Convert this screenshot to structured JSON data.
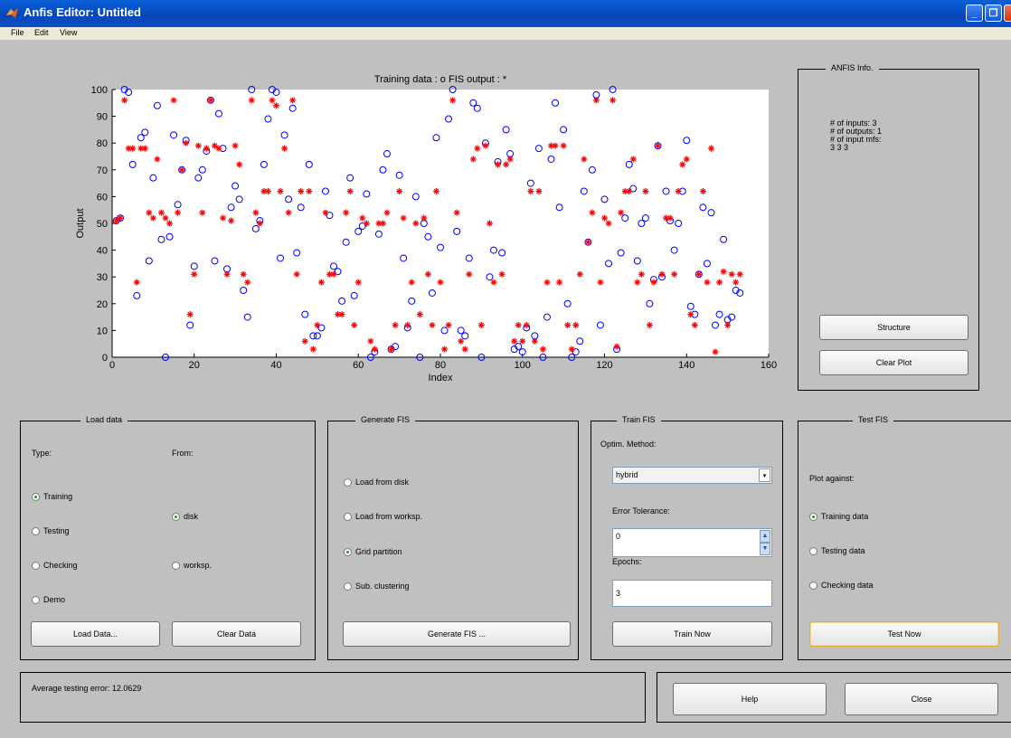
{
  "window": {
    "title": "Anfis Editor: Untitled"
  },
  "menu": [
    "File",
    "Edit",
    "View"
  ],
  "chart_data": {
    "type": "scatter",
    "title": "Training data : o   FIS output : *",
    "xlabel": "Index",
    "ylabel": "Output",
    "xlim": [
      0,
      160
    ],
    "ylim": [
      0,
      100
    ],
    "xticks": [
      "0",
      "20",
      "40",
      "60",
      "80",
      "100",
      "120",
      "140",
      "160"
    ],
    "yticks": [
      "0",
      "10",
      "20",
      "30",
      "40",
      "50",
      "60",
      "70",
      "80",
      "90",
      "100"
    ],
    "series": [
      {
        "name": "Training data",
        "marker": "o",
        "color": "#0000ff",
        "values": [
          51,
          52,
          100,
          99,
          72,
          23,
          82,
          84,
          36,
          67,
          94,
          44,
          0,
          45,
          83,
          57,
          70,
          81,
          12,
          34,
          67,
          70,
          77,
          96,
          36,
          91,
          78,
          33,
          56,
          64,
          59,
          25,
          15,
          100,
          48,
          51,
          72,
          89,
          100,
          99,
          37,
          83,
          59,
          93,
          39,
          56,
          16,
          72,
          8,
          8,
          11,
          62,
          53,
          34,
          32,
          21,
          43,
          67,
          23,
          47,
          49,
          61,
          0,
          2,
          46,
          70,
          76,
          3,
          4,
          68,
          37,
          11,
          21,
          60,
          0,
          50,
          45,
          24,
          82,
          41,
          10,
          89,
          100,
          47,
          10,
          8,
          37,
          95,
          93,
          0,
          80,
          30,
          40,
          73,
          39,
          85,
          76,
          3,
          4,
          2,
          11,
          65,
          8,
          78,
          0,
          15,
          74,
          95,
          56,
          85,
          20,
          0,
          2,
          6,
          62,
          43,
          70,
          98,
          12,
          59,
          35,
          100,
          3,
          39,
          52,
          72,
          63,
          36,
          50,
          52,
          20,
          29,
          79,
          30,
          62,
          51,
          40,
          50,
          62,
          81,
          19,
          16,
          31,
          56,
          35,
          54,
          12,
          16,
          44,
          14,
          15,
          25,
          24
        ]
      },
      {
        "name": "FIS output",
        "marker": "*",
        "color": "#ff0000",
        "values": [
          51,
          52,
          96,
          78,
          78,
          28,
          78,
          78,
          54,
          52,
          74,
          54,
          52,
          50,
          96,
          54,
          70,
          80,
          16,
          31,
          79,
          54,
          78,
          96,
          79,
          78,
          52,
          31,
          51,
          79,
          72,
          31,
          28,
          96,
          54,
          50,
          62,
          62,
          96,
          94,
          62,
          78,
          54,
          96,
          31,
          62,
          6,
          62,
          3,
          12,
          28,
          54,
          31,
          31,
          16,
          16,
          54,
          62,
          12,
          28,
          52,
          50,
          6,
          3,
          50,
          50,
          54,
          3,
          12,
          62,
          52,
          12,
          28,
          50,
          16,
          52,
          31,
          12,
          62,
          28,
          3,
          12,
          96,
          54,
          6,
          3,
          31,
          74,
          78,
          12,
          79,
          50,
          28,
          72,
          31,
          72,
          74,
          6,
          12,
          6,
          12,
          62,
          6,
          62,
          3,
          28,
          79,
          79,
          28,
          79,
          12,
          3,
          12,
          31,
          74,
          43,
          54,
          96,
          28,
          52,
          50,
          96,
          4,
          54,
          62,
          62,
          74,
          28,
          31,
          62,
          12,
          28,
          79,
          31,
          52,
          52,
          31,
          62,
          72,
          74,
          16,
          12,
          31,
          62,
          28,
          78,
          2,
          28,
          32,
          12,
          31,
          28,
          31
        ]
      }
    ]
  },
  "anfis_info": {
    "title": "ANFIS Info.",
    "line1": "# of inputs: 3",
    "line2": "# of outputs: 1",
    "line3": "# of input mfs:",
    "line4": "3 3 3",
    "structure_label": "Structure",
    "clear_plot_label": "Clear Plot"
  },
  "load_data": {
    "title": "Load data",
    "type_label": "Type:",
    "from_label": "From:",
    "types": [
      "Training",
      "Testing",
      "Checking",
      "Demo"
    ],
    "selected_type": "Training",
    "sources": [
      "disk",
      "worksp."
    ],
    "selected_source": "disk",
    "load_button": "Load Data...",
    "clear_button": "Clear Data"
  },
  "generate_fis": {
    "title": "Generate FIS",
    "options": [
      "Load from disk",
      "Load from worksp.",
      "Grid partition",
      "Sub. clustering"
    ],
    "selected": "Grid partition",
    "button": "Generate FIS ..."
  },
  "train_fis": {
    "title": "Train FIS",
    "method_label": "Optim. Method:",
    "method_value": "hybrid",
    "tolerance_label": "Error Tolerance:",
    "tolerance_value": "0",
    "epochs_label": "Epochs:",
    "epochs_value": "3",
    "button": "Train Now"
  },
  "test_fis": {
    "title": "Test FIS",
    "plot_against_label": "Plot against:",
    "options": [
      "Training data",
      "Testing data",
      "Checking data"
    ],
    "selected": "Training data",
    "button": "Test Now"
  },
  "status": {
    "text": "Average testing error: 12.0629"
  },
  "footer": {
    "help_label": "Help",
    "close_label": "Close"
  }
}
